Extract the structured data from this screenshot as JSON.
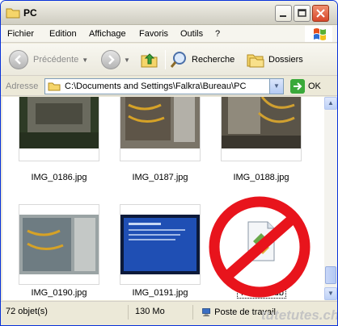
{
  "window": {
    "title": "PC"
  },
  "menu": [
    "Fichier",
    "Edition",
    "Affichage",
    "Favoris",
    "Outils",
    "?"
  ],
  "toolbar": {
    "back_label": "Précédente",
    "search_label": "Recherche",
    "folders_label": "Dossiers"
  },
  "address": {
    "label": "Adresse",
    "path": "C:\\Documents and Settings\\Falkra\\Bureau\\PC",
    "go_label": "OK"
  },
  "files": [
    {
      "name": "IMG_0186.jpg",
      "type": "image"
    },
    {
      "name": "IMG_0187.jpg",
      "type": "image"
    },
    {
      "name": "IMG_0188.jpg",
      "type": "image"
    },
    {
      "name": "IMG_0190.jpg",
      "type": "image"
    },
    {
      "name": "IMG_0191.jpg",
      "type": "image"
    },
    {
      "name": "Thumbs.db",
      "type": "system-file",
      "selected": true
    }
  ],
  "status": {
    "count": "72 objet(s)",
    "size": "130 Mo",
    "location": "Poste de travail"
  },
  "watermark": "tutetutes.ch",
  "colors": {
    "forbidden_sign": "#e8141c",
    "selection": "#316ac5"
  }
}
